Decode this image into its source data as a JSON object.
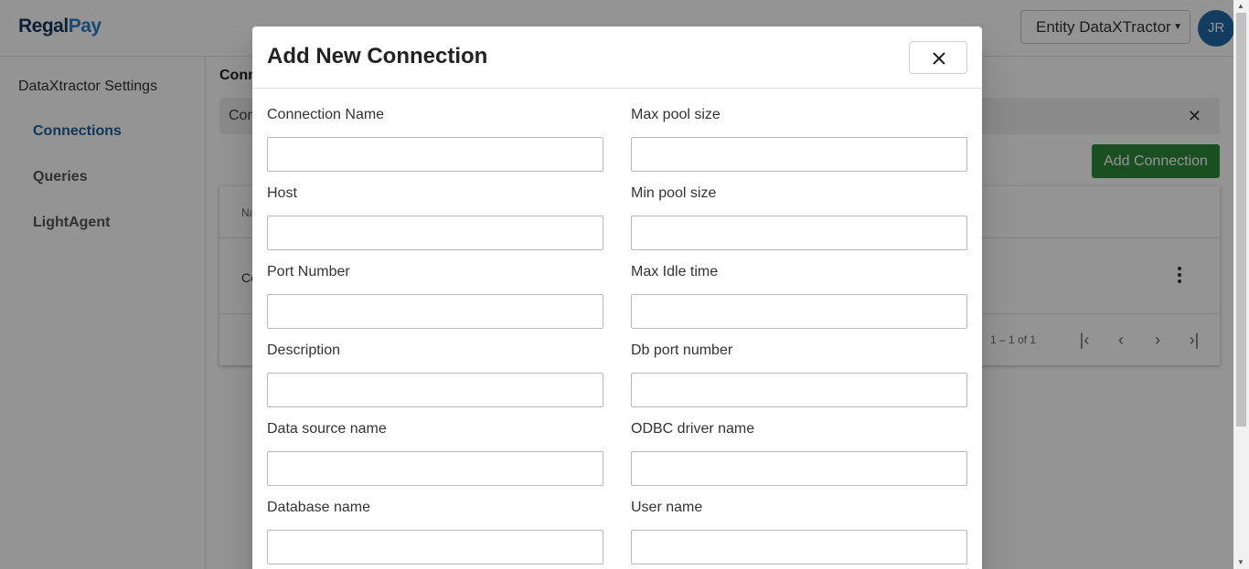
{
  "brand": {
    "logo_part1": "Regal",
    "logo_part2": "Pay"
  },
  "header": {
    "entity_selector_value": "Entity DataXTractor",
    "avatar_initials": "JR"
  },
  "sidebar": {
    "title": "DataXtractor Settings",
    "items": [
      {
        "label": "Connections",
        "active": true
      },
      {
        "label": "Queries",
        "active": false
      },
      {
        "label": "LightAgent",
        "active": false
      }
    ]
  },
  "main": {
    "heading": "Conn",
    "banner_text": "Con",
    "add_connection_label": "Add Connection",
    "table": {
      "header_first_col": "Na",
      "row_first_cell": "Co",
      "paginator_range": "1 – 1 of 1"
    }
  },
  "dialog": {
    "title": "Add New Connection",
    "fields": [
      {
        "label": "Connection Name",
        "value": ""
      },
      {
        "label": "Max pool size",
        "value": ""
      },
      {
        "label": "Host",
        "value": ""
      },
      {
        "label": "Min pool size",
        "value": ""
      },
      {
        "label": "Port Number",
        "value": ""
      },
      {
        "label": "Max Idle time",
        "value": ""
      },
      {
        "label": "Description",
        "value": ""
      },
      {
        "label": "Db port number",
        "value": ""
      },
      {
        "label": "Data source name",
        "value": ""
      },
      {
        "label": "ODBC driver name",
        "value": ""
      },
      {
        "label": "Database name",
        "value": ""
      },
      {
        "label": "User name",
        "value": ""
      }
    ]
  },
  "colors": {
    "primary_blue": "#1e5f99",
    "add_button_green": "#2e8b3a",
    "avatar_blue": "#1f6aa6"
  }
}
